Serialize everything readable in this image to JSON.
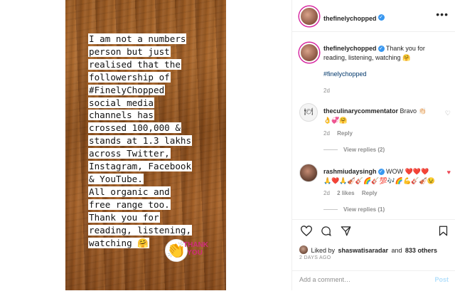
{
  "story": {
    "lines": [
      "I am not a numbers",
      "person but just",
      "realised that the",
      "followership of",
      "#FinelyChopped",
      "social media",
      "channels has",
      "crossed 100,000 &",
      "stands at 1.3 lakhs",
      "across Twitter,",
      "Instagram, Facebook",
      "& YouTube.",
      "All organic and",
      "free range too.",
      "Thank you for",
      "reading, listening,",
      "watching 🤗"
    ],
    "sticker_text": "THANK YOU",
    "sticker_icon": "clapping-hands"
  },
  "header": {
    "username": "thefinelychopped",
    "more": "•••"
  },
  "caption": {
    "username": "thefinelychopped",
    "text": "Thank you for reading, listening, watching 🤗",
    "hashtag": "#finelychopped",
    "time": "2d"
  },
  "comments": [
    {
      "username": "theculinarycommentator",
      "text": "Bravo 👏🏻",
      "text2": "👌💞🤗",
      "time": "2d",
      "reply": "Reply",
      "likes": "",
      "view_replies": "View replies (2)"
    },
    {
      "username": "rashmiudaysingh",
      "text": "WOW ❤️❤️❤️",
      "text2": "🙏❤️🙏🎻🎸🌈🎸💯🎶🌈💪🎸🎻😉",
      "time": "2d",
      "likes": "2 likes",
      "reply": "Reply",
      "view_replies": "View replies (1)"
    }
  ],
  "actions": {
    "liked_by_prefix": "Liked by",
    "liked_by_user": "shaswatisaradar",
    "liked_by_and": "and",
    "liked_count": "833 others",
    "date": "2 DAYS AGO"
  },
  "add_comment": {
    "placeholder": "Add a comment…",
    "post": "Post"
  }
}
